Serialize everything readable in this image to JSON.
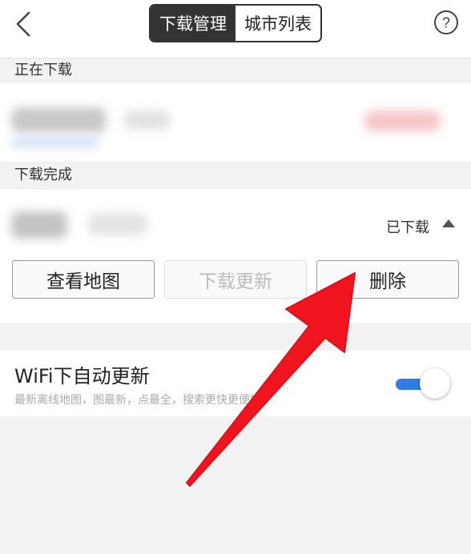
{
  "header": {
    "tabs": [
      {
        "label": "下载管理",
        "active": true
      },
      {
        "label": "城市列表",
        "active": false
      }
    ]
  },
  "sections": {
    "downloading": {
      "title": "正在下载"
    },
    "completed": {
      "title": "下载完成",
      "item": {
        "status": "已下载",
        "buttons": {
          "view_map": "查看地图",
          "update": "下载更新",
          "delete": "删除"
        }
      }
    }
  },
  "wifi": {
    "title": "WiFi下自动更新",
    "subtitle": "最新离线地图，图最新，点最全，搜索更快更便捷",
    "enabled": true
  },
  "colors": {
    "accent": "#2f7be3",
    "arrow": "#f0141e",
    "segment_active": "#333333"
  },
  "icons": [
    "back-arrow-icon",
    "help-question-icon",
    "caret-up-icon"
  ]
}
